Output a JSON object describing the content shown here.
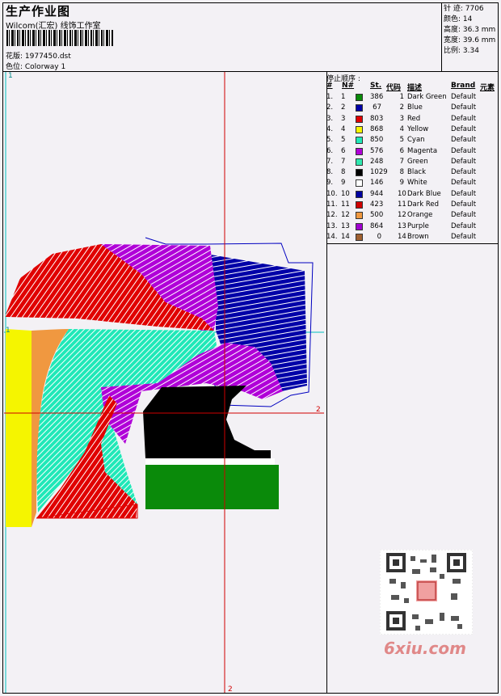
{
  "header": {
    "title": "生产作业图",
    "subtitle": "Wilcom(汇宏) 线饰工作室",
    "file_label": "花版: 1977450.dst",
    "colorway_label": "色位: Colorway 1"
  },
  "stats": {
    "stitches": "针 迹: 7706",
    "colors": "颜色: 14",
    "height": "高度: 36.3 mm",
    "width": "宽度: 39.6 mm",
    "ratio": "比例: 3.34"
  },
  "table": {
    "title": "停止顺序 :",
    "headers": {
      "num": "#",
      "n": "N#",
      "st": "St.",
      "code": "代码",
      "desc": "描述",
      "brand": "Brand",
      "elem": "元素"
    },
    "rows": [
      {
        "num": "1.",
        "n": "1",
        "st": "386",
        "code": "1",
        "desc": "Dark Green",
        "brand": "Default",
        "color": "#0a8a0a"
      },
      {
        "num": "2.",
        "n": "2",
        "st": "67",
        "code": "2",
        "desc": "Blue",
        "brand": "Default",
        "color": "#0000a8"
      },
      {
        "num": "3.",
        "n": "3",
        "st": "803",
        "code": "3",
        "desc": "Red",
        "brand": "Default",
        "color": "#e00000"
      },
      {
        "num": "4.",
        "n": "4",
        "st": "868",
        "code": "4",
        "desc": "Yellow",
        "brand": "Default",
        "color": "#f5f500"
      },
      {
        "num": "5.",
        "n": "5",
        "st": "850",
        "code": "5",
        "desc": "Cyan",
        "brand": "Default",
        "color": "#20e8b8"
      },
      {
        "num": "6.",
        "n": "6",
        "st": "576",
        "code": "6",
        "desc": "Magenta",
        "brand": "Default",
        "color": "#b000d8"
      },
      {
        "num": "7.",
        "n": "7",
        "st": "248",
        "code": "7",
        "desc": "Green",
        "brand": "Default",
        "color": "#30e8b0"
      },
      {
        "num": "8.",
        "n": "8",
        "st": "1029",
        "code": "8",
        "desc": "Black",
        "brand": "Default",
        "color": "#000000"
      },
      {
        "num": "9.",
        "n": "9",
        "st": "146",
        "code": "9",
        "desc": "White",
        "brand": "Default",
        "color": "#ffffff"
      },
      {
        "num": "10.",
        "n": "10",
        "st": "944",
        "code": "10",
        "desc": "Dark Blue",
        "brand": "Default",
        "color": "#0000a0"
      },
      {
        "num": "11.",
        "n": "11",
        "st": "423",
        "code": "11",
        "desc": "Dark Red",
        "brand": "Default",
        "color": "#d00000"
      },
      {
        "num": "12.",
        "n": "12",
        "st": "500",
        "code": "12",
        "desc": "Orange",
        "brand": "Default",
        "color": "#f09840"
      },
      {
        "num": "13.",
        "n": "13",
        "st": "864",
        "code": "13",
        "desc": "Purple",
        "brand": "Default",
        "color": "#a000d0"
      },
      {
        "num": "14.",
        "n": "14",
        "st": "0",
        "code": "14",
        "desc": "Brown",
        "brand": "Default",
        "color": "#a06030"
      }
    ]
  },
  "axes": {
    "marker_1": "1",
    "marker_2": "2"
  },
  "watermark": "6xiu.com"
}
